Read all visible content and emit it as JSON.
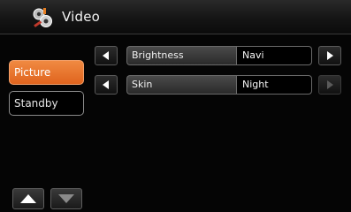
{
  "header": {
    "title": "Video",
    "icon": "video-settings-icon"
  },
  "sidebar": {
    "items": [
      {
        "label": "Picture",
        "active": true
      },
      {
        "label": "Standby",
        "active": false
      }
    ]
  },
  "settings": [
    {
      "label": "Brightness",
      "value": "Navi",
      "next_enabled": true
    },
    {
      "label": "Skin",
      "value": "Night",
      "next_enabled": false
    }
  ],
  "colors": {
    "accent": "#E8722E",
    "background": "#000000",
    "disabled_arrow": "#5A5A5A"
  },
  "icons": {
    "prev": "left-arrow-icon",
    "next": "right-arrow-icon",
    "up": "up-arrow-icon",
    "down": "down-arrow-icon"
  }
}
